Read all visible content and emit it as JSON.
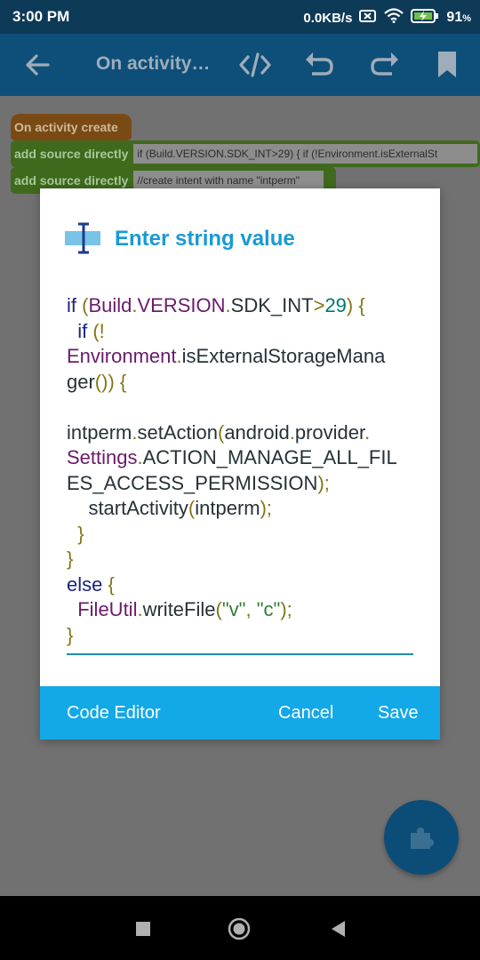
{
  "status_bar": {
    "time": "3:00 PM",
    "net_speed": "0.0KB/s",
    "battery": "91",
    "battery_unit": "%"
  },
  "toolbar": {
    "title": "On activity…",
    "icons": [
      "back-arrow",
      "code-tags",
      "undo",
      "redo",
      "bookmark"
    ]
  },
  "blocks": {
    "event_label": "On activity create",
    "source1_label": "add source directly",
    "source1_value": "if (Build.VERSION.SDK_INT>29) {     if (!Environment.isExternalSt",
    "source2_label": "add source directly",
    "source2_value": "//create intent with name \"intperm\""
  },
  "dialog": {
    "title": "Enter string value",
    "icon": "text-cursor",
    "buttons": {
      "code_editor": "Code Editor",
      "cancel": "Cancel",
      "save": "Save"
    }
  },
  "colors": {
    "accent": "#13a8e8",
    "title": "#199ad6",
    "toolbar": "#0e4f7a"
  }
}
